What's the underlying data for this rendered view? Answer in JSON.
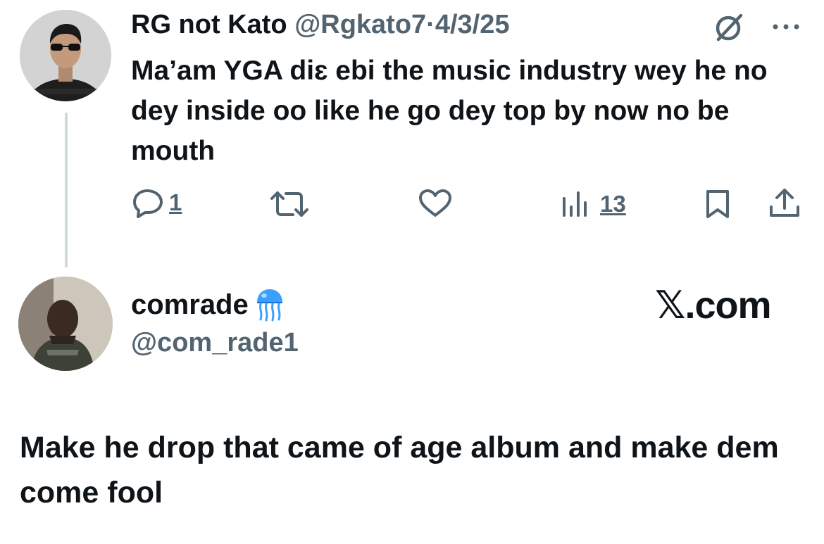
{
  "original_tweet": {
    "display_name": "RG not Kato",
    "handle": "@Rgkato7",
    "separator": "·",
    "date": "4/3/25",
    "text": "Ma’am YGA diɛ ebi the music industry wey he no dey inside oo like he go dey top by now no be mouth",
    "actions": {
      "reply_count": "1",
      "views_count": "13"
    },
    "icons": [
      "reply-icon",
      "retweet-icon",
      "like-icon",
      "views-icon",
      "bookmark-icon",
      "share-icon",
      "grok-icon",
      "more-icon"
    ]
  },
  "reply_card": {
    "display_name": "comrade",
    "emoji": "jellyfish-emoji",
    "handle": "@com_rade1",
    "site": "𝕏.com",
    "text": "Make he drop that came of age album and make dem come fool"
  },
  "colors": {
    "text": "#0f1419",
    "secondary": "#536471",
    "thread_line": "#cfd9de",
    "jellyfish": "#3aa0ff"
  }
}
